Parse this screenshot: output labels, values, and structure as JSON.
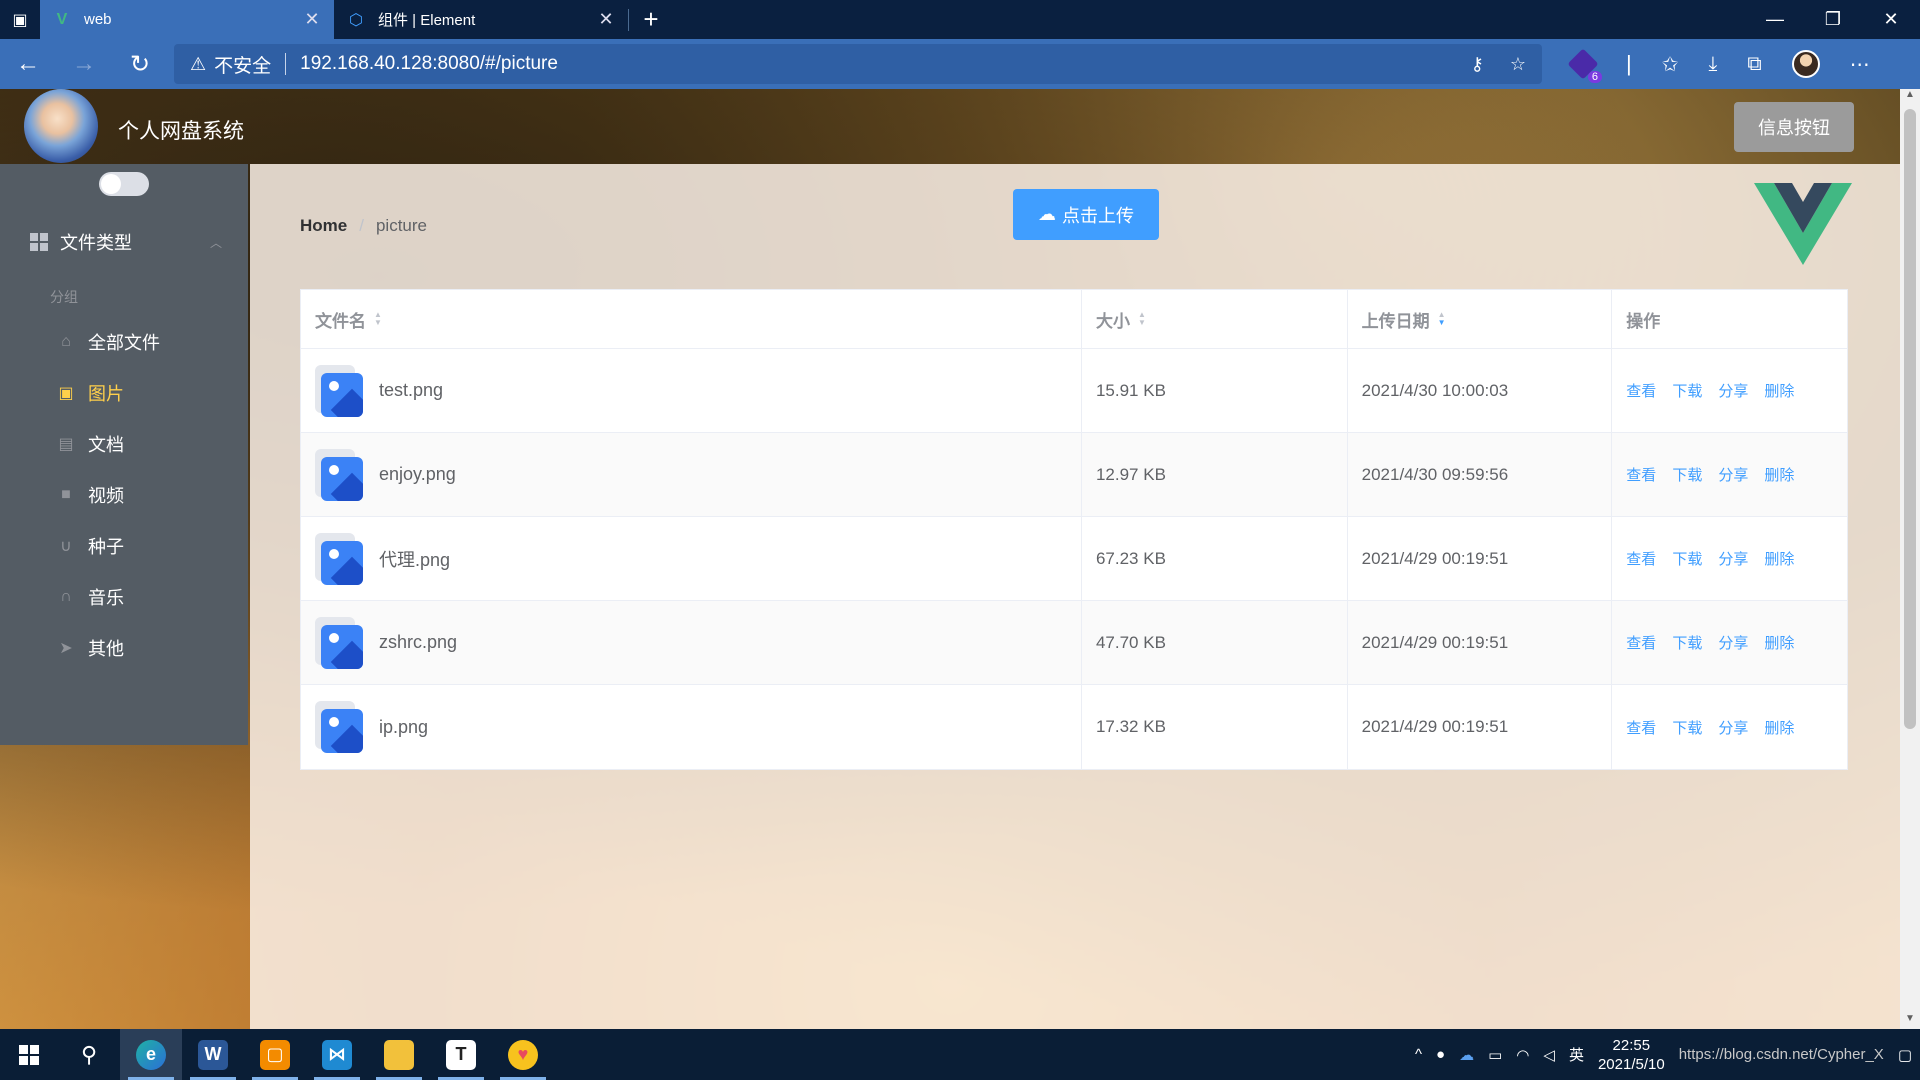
{
  "browser": {
    "tabs": [
      {
        "title": "web",
        "favicon": "vue-favicon",
        "active": true
      },
      {
        "title": "组件 | Element",
        "favicon": "element-favicon",
        "active": false
      }
    ],
    "security_label": "不安全",
    "url": "192.168.40.128:8080/#/picture",
    "extension_badge": "6"
  },
  "app": {
    "title": "个人网盘系统",
    "info_button": "信息按钮"
  },
  "sidebar": {
    "submenu_title": "文件类型",
    "group_label": "分组",
    "items": [
      {
        "label": "全部文件",
        "icon": "home-icon",
        "active": false
      },
      {
        "label": "图片",
        "icon": "picture-icon",
        "active": true
      },
      {
        "label": "文档",
        "icon": "document-icon",
        "active": false
      },
      {
        "label": "视频",
        "icon": "video-camera-icon",
        "active": false
      },
      {
        "label": "种子",
        "icon": "magnet-icon",
        "active": false
      },
      {
        "label": "音乐",
        "icon": "headset-icon",
        "active": false
      },
      {
        "label": "其他",
        "icon": "paper-plane-icon",
        "active": false
      }
    ]
  },
  "main": {
    "breadcrumb": {
      "home": "Home",
      "separator": "/",
      "current": "picture"
    },
    "upload_button": "点击上传",
    "table": {
      "columns": [
        "文件名",
        "大小",
        "上传日期",
        "操作"
      ],
      "actions": [
        "查看",
        "下载",
        "分享",
        "删除"
      ],
      "rows": [
        {
          "name": "test.png",
          "size": "15.91 KB",
          "date": "2021/4/30 10:00:03"
        },
        {
          "name": "enjoy.png",
          "size": "12.97 KB",
          "date": "2021/4/30 09:59:56"
        },
        {
          "name": "代理.png",
          "size": "67.23 KB",
          "date": "2021/4/29 00:19:51"
        },
        {
          "name": "zshrc.png",
          "size": "47.70 KB",
          "date": "2021/4/29 00:19:51"
        },
        {
          "name": "ip.png",
          "size": "17.32 KB",
          "date": "2021/4/29 00:19:51"
        }
      ]
    }
  },
  "taskbar": {
    "ime_label": "英",
    "time": "22:55",
    "date": "2021/5/10",
    "watermark": "https://blog.csdn.net/Cypher_X"
  },
  "colors": {
    "accent": "#409eff",
    "sidebar_bg": "#545c64",
    "menu_active": "#ffd04b",
    "vue_green": "#41b883",
    "vue_dark": "#35495e"
  }
}
